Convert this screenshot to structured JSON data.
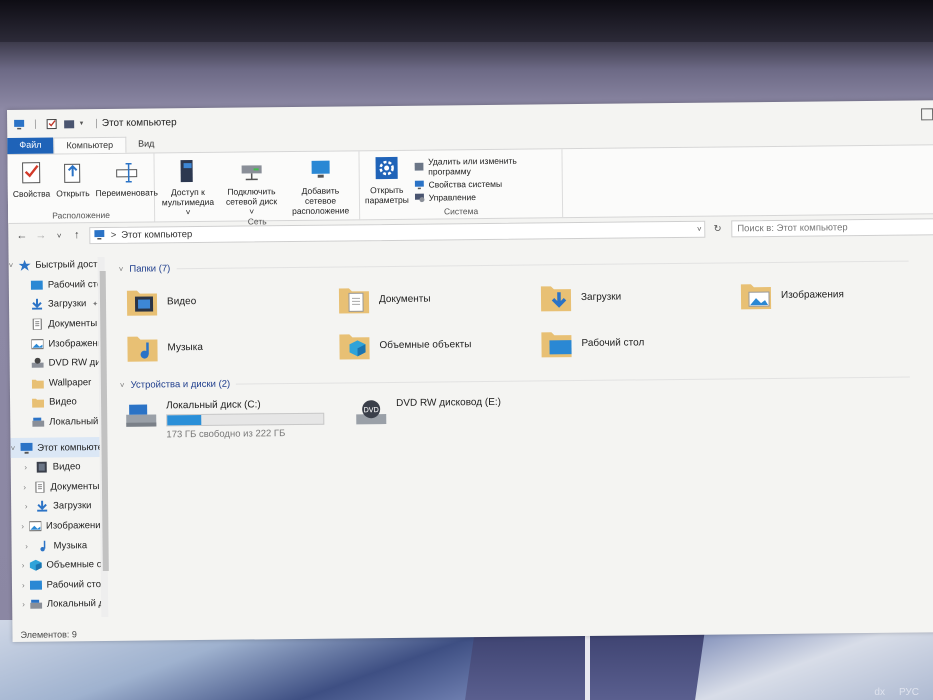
{
  "window": {
    "title": "Этот компьютер",
    "separator": "|",
    "tabs": [
      {
        "label": "Файл"
      },
      {
        "label": "Компьютер"
      },
      {
        "label": "Вид"
      }
    ]
  },
  "ribbon": {
    "location": {
      "label": "Расположение",
      "buttons": [
        "Свойства",
        "Открыть",
        "Переименовать"
      ]
    },
    "network": {
      "label": "Сеть",
      "buttons": [
        {
          "line1": "Доступ к",
          "line2": "мультимедиа ˅"
        },
        {
          "line1": "Подключить",
          "line2": "сетевой диск ˅"
        },
        {
          "line1": "Добавить сетевое",
          "line2": "расположение"
        }
      ]
    },
    "system": {
      "label": "Система",
      "open_params": {
        "line1": "Открыть",
        "line2": "параметры"
      },
      "links": [
        "Удалить или изменить программу",
        "Свойства системы",
        "Управление"
      ]
    }
  },
  "address": {
    "back": "←",
    "forward": "→",
    "recent": "˅",
    "up": "↑",
    "path_arrow": ">",
    "path": "Этот компьютер",
    "dropdown": "˅",
    "refresh": "↻",
    "search_placeholder": "Поиск в: Этот компьютер"
  },
  "nav": {
    "quick_access": {
      "label": "Быстрый доступ",
      "items": [
        {
          "label": "Рабочий стол",
          "pinned": "✦"
        },
        {
          "label": "Загрузки",
          "pinned": "✦"
        },
        {
          "label": "Документы",
          "pinned": "✦"
        },
        {
          "label": "Изображени",
          "pinned": "✦"
        },
        {
          "label": "DVD RW дисково",
          "pinned": ""
        },
        {
          "label": "Wallpaper",
          "pinned": ""
        },
        {
          "label": "Видео",
          "pinned": ""
        },
        {
          "label": "Локальный диск",
          "pinned": ""
        }
      ]
    },
    "this_pc": {
      "label": "Этот компьютер",
      "items": [
        "Видео",
        "Документы",
        "Загрузки",
        "Изображения",
        "Музыка",
        "Объемные объе",
        "Рабочий стол",
        "Локальный диск"
      ]
    }
  },
  "content": {
    "folders_header": "Папки (7)",
    "folders": [
      {
        "label": "Видео",
        "icon": "video-folder-icon"
      },
      {
        "label": "Документы",
        "icon": "documents-folder-icon"
      },
      {
        "label": "Загрузки",
        "icon": "downloads-folder-icon"
      },
      {
        "label": "Изображения",
        "icon": "pictures-folder-icon"
      },
      {
        "label": "Музыка",
        "icon": "music-folder-icon"
      },
      {
        "label": "Объемные объекты",
        "icon": "3d-objects-folder-icon"
      },
      {
        "label": "Рабочий стол",
        "icon": "desktop-folder-icon"
      }
    ],
    "devices_header": "Устройства и диски (2)",
    "drives": {
      "local": {
        "label": "Локальный диск (C:)",
        "free": "173 ГБ свободно из 222 ГБ",
        "used_fraction": 0.22
      },
      "dvd": {
        "label": "DVD RW дисковод (E:)",
        "badge": "DVD"
      }
    }
  },
  "status": {
    "items": "Элементов: 9"
  },
  "tray": {
    "d": "dx",
    "lang": "РУС"
  },
  "colors": {
    "accent": "#1f63b8",
    "selection": "#dbe7f5",
    "folder": "#e8c074",
    "drive_bar": "#2a8fd8"
  }
}
